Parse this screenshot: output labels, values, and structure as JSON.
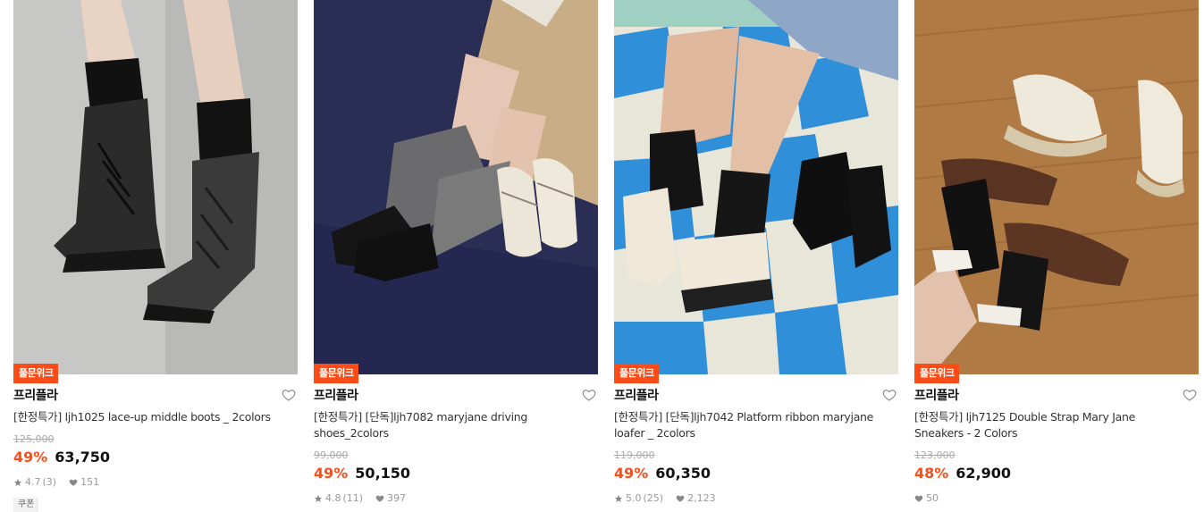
{
  "products": [
    {
      "badge": "풀문위크",
      "brand": "프리플라",
      "title": "[한정특가] ljh1025 lace-up middle boots _ 2colors",
      "original_price": "125,000",
      "discount": "49%",
      "price": "63,750",
      "rating": "4.7",
      "reviews": "(3)",
      "likes": "151",
      "coupon": "쿠폰",
      "image": "black lace-up boots with black socks"
    },
    {
      "badge": "풀문위크",
      "brand": "프리플라",
      "title": "[한정특가] [단독]ljh7082 maryjane driving shoes_2colors",
      "original_price": "99,000",
      "discount": "49%",
      "price": "50,150",
      "rating": "4.8",
      "reviews": "(11)",
      "likes": "397",
      "image": "maryjane driving shoes on navy sofa"
    },
    {
      "badge": "풀문위크",
      "brand": "프리플라",
      "title": "[한정특가] [단독]ljh7042 Platform ribbon maryjane loafer _ 2colors",
      "original_price": "119,000",
      "discount": "49%",
      "price": "60,350",
      "rating": "5.0",
      "reviews": "(25)",
      "likes": "2,123",
      "image": "platform ribbon maryjane on blue checkered floor"
    },
    {
      "badge": "풀문위크",
      "brand": "프리플라",
      "title": "[한정특가] ljh7125 Double Strap Mary Jane Sneakers - 2 Colors",
      "original_price": "123,000",
      "discount": "48%",
      "price": "62,900",
      "likes": "50",
      "image": "double strap mary jane sneakers on wooden floor"
    }
  ],
  "colors": {
    "accent": "#ff4b16",
    "muted": "#999999"
  },
  "icons": {
    "wishlist": "heart-outline-icon",
    "rating": "star-icon",
    "likes": "heart-filled-icon"
  }
}
